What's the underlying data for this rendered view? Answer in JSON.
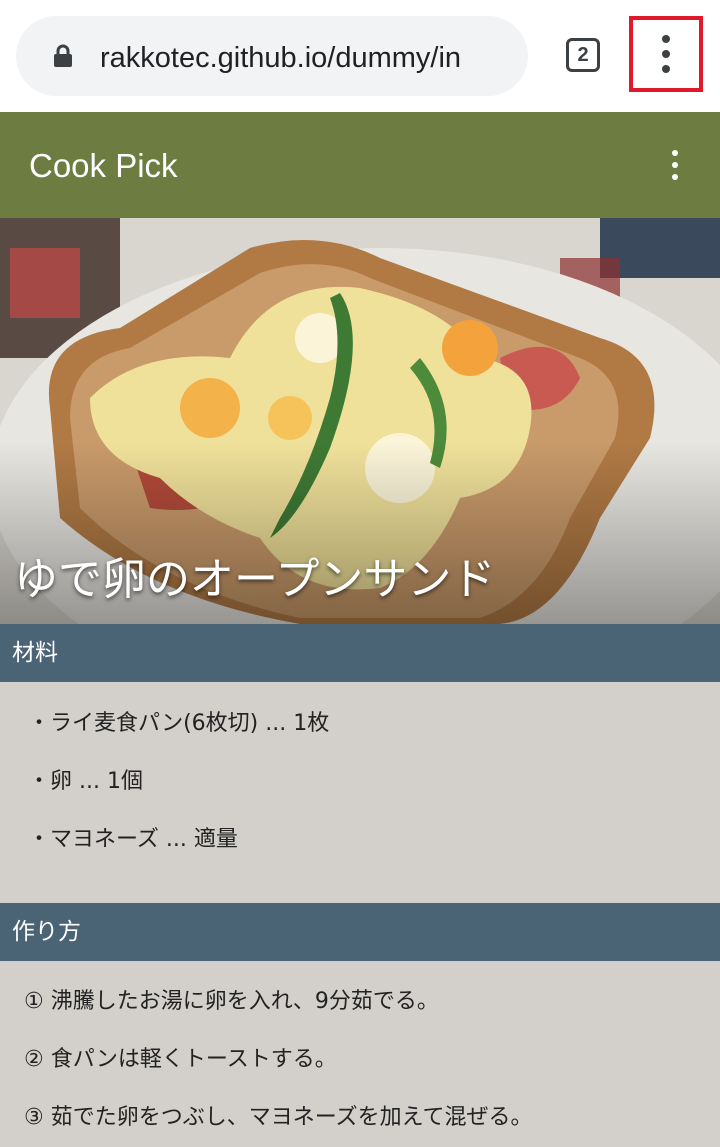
{
  "browser": {
    "url": "rakkotec.github.io/dummy/in",
    "tab_count": "2",
    "lock_icon": "lock-icon",
    "menu_icon": "more-vert-icon",
    "highlight_color": "#e0192b"
  },
  "app": {
    "title": "Cook Pick",
    "bar_color": "#6d7d41",
    "menu_icon": "more-vert-icon"
  },
  "recipe": {
    "title": "ゆで卵のオープンサンド",
    "image": "open-egg-sandwich-photo"
  },
  "ingredients": {
    "heading": "材料",
    "items": [
      "・ライ麦食パン(6枚切) ... 1枚",
      "・卵 ... 1個",
      "・マヨネーズ ... 適量"
    ]
  },
  "steps": {
    "heading": "作り方",
    "items": [
      "① 沸騰したお湯に卵を入れ、9分茹でる。",
      "② 食パンは軽くトーストする。",
      "③ 茹でた卵をつぶし、マヨネーズを加えて混ぜる。"
    ]
  },
  "colors": {
    "section_header": "#4a6375",
    "content_bg": "#d3d0cb"
  }
}
